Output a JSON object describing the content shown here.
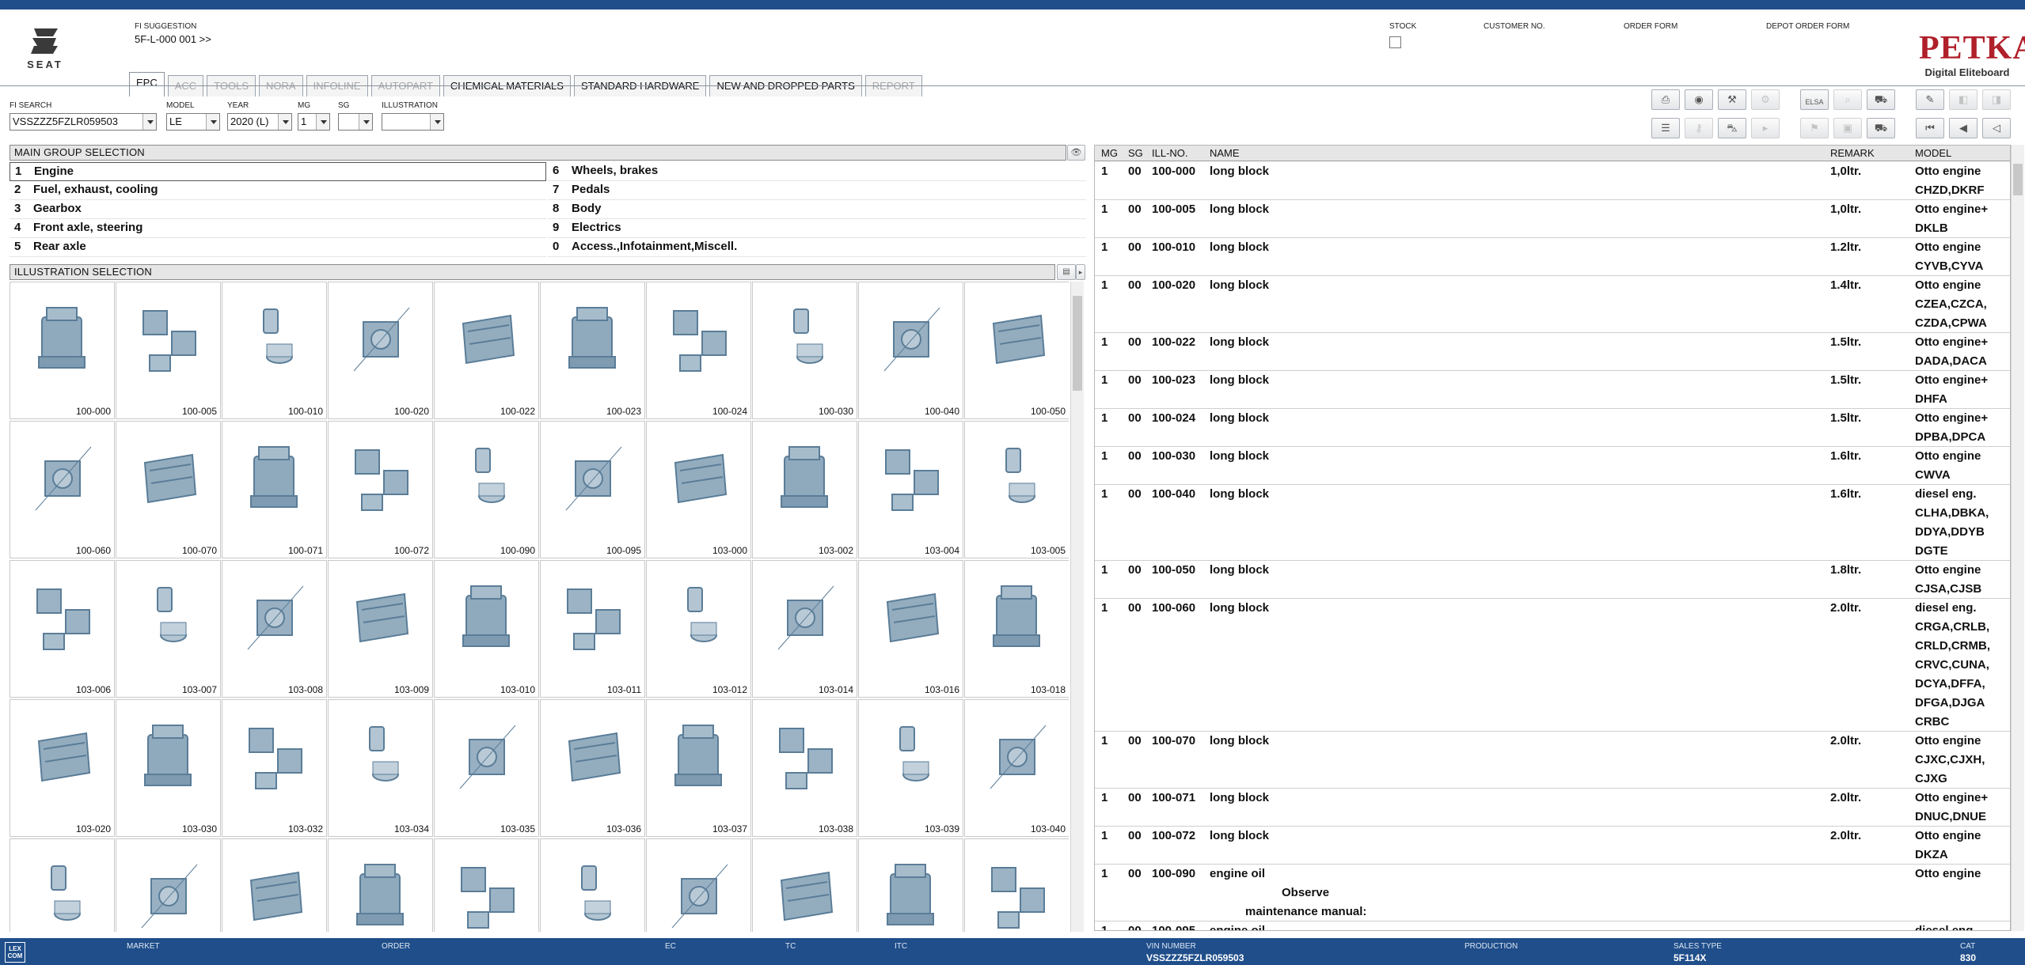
{
  "app": {
    "brand": "SEAT",
    "product_name": "PETKA",
    "product_sub": "Digital Eliteboard"
  },
  "header": {
    "fi_suggestion_label": "FI SUGGESTION",
    "fi_suggestion_value": "5F-L-000 001 >>",
    "stock_label": "STOCK",
    "customer_no_label": "CUSTOMER NO.",
    "order_form_label": "ORDER FORM",
    "depot_order_form_label": "DEPOT ORDER FORM"
  },
  "tabs": [
    {
      "label": "EPC",
      "state": "active"
    },
    {
      "label": "ACC",
      "state": "disabled"
    },
    {
      "label": "TOOLS",
      "state": "disabled"
    },
    {
      "label": "NORA",
      "state": "disabled"
    },
    {
      "label": "INFOLINE",
      "state": "disabled"
    },
    {
      "label": "AUTOPART",
      "state": "disabled"
    },
    {
      "label": "CHEMICAL MATERIALS",
      "state": "enabled"
    },
    {
      "label": "STANDARD HARDWARE",
      "state": "enabled"
    },
    {
      "label": "NEW AND DROPPED PARTS",
      "state": "enabled"
    },
    {
      "label": "REPORT",
      "state": "disabled"
    }
  ],
  "filters": {
    "fi_search": {
      "label": "FI SEARCH",
      "value": "VSSZZZ5FZLR059503"
    },
    "model": {
      "label": "MODEL",
      "value": "LE"
    },
    "year": {
      "label": "YEAR",
      "value": "2020 (L)"
    },
    "mg": {
      "label": "MG",
      "value": "1"
    },
    "sg": {
      "label": "SG",
      "value": ""
    },
    "illustration": {
      "label": "ILLUSTRATION",
      "value": ""
    }
  },
  "toolbar": {
    "row1": [
      "print-icon",
      "catalog-icon",
      "wrench-icon",
      "tools-disabled-icon",
      "elsa-icon",
      "search-disabled-icon",
      "cart-add-icon",
      "pin-icon",
      "back-disabled-icon",
      "forward-disabled-icon"
    ],
    "row2": [
      "list-icon",
      "key-icon",
      "car-icon",
      "next-disabled-icon",
      "flag-disabled-icon",
      "camera-disabled-icon",
      "cart-icon",
      "first-icon",
      "previous-icon",
      "prev-small-icon"
    ],
    "elsa_label": "ELSA"
  },
  "main_group": {
    "title": "MAIN GROUP SELECTION",
    "left": [
      {
        "num": "1",
        "label": "Engine"
      },
      {
        "num": "2",
        "label": "Fuel, exhaust, cooling"
      },
      {
        "num": "3",
        "label": "Gearbox"
      },
      {
        "num": "4",
        "label": "Front axle, steering"
      },
      {
        "num": "5",
        "label": "Rear axle"
      }
    ],
    "right": [
      {
        "num": "6",
        "label": "Wheels, brakes"
      },
      {
        "num": "7",
        "label": "Pedals"
      },
      {
        "num": "8",
        "label": "Body"
      },
      {
        "num": "9",
        "label": "Electrics"
      },
      {
        "num": "0",
        "label": "Access.,Infotainment,Miscell."
      }
    ]
  },
  "illustration_selection": {
    "title": "ILLUSTRATION SELECTION",
    "items": [
      "100-000",
      "100-005",
      "100-010",
      "100-020",
      "100-022",
      "100-023",
      "100-024",
      "100-030",
      "100-040",
      "100-050",
      "100-060",
      "100-070",
      "100-071",
      "100-072",
      "100-090",
      "100-095",
      "103-000",
      "103-002",
      "103-004",
      "103-005",
      "103-006",
      "103-007",
      "103-008",
      "103-009",
      "103-010",
      "103-011",
      "103-012",
      "103-014",
      "103-016",
      "103-018",
      "103-020",
      "103-030",
      "103-032",
      "103-034",
      "103-035",
      "103-036",
      "103-037",
      "103-038",
      "103-039",
      "103-040",
      "",
      "",
      "",
      "",
      "",
      "",
      "",
      "",
      "",
      ""
    ]
  },
  "parts_table": {
    "columns": {
      "mg": "MG",
      "sg": "SG",
      "ill": "ILL-NO.",
      "name": "NAME",
      "remark": "REMARK",
      "model": "MODEL"
    },
    "rows": [
      {
        "mg": "1",
        "sg": "00",
        "ill": "100-000",
        "name": "long block",
        "remark": "1,0ltr.",
        "model": [
          "Otto engine",
          "CHZD,DKRF"
        ]
      },
      {
        "mg": "1",
        "sg": "00",
        "ill": "100-005",
        "name": "long block",
        "remark": "1,0ltr.",
        "model": [
          "Otto engine+",
          "DKLB"
        ]
      },
      {
        "mg": "1",
        "sg": "00",
        "ill": "100-010",
        "name": "long block",
        "remark": "1.2ltr.",
        "model": [
          "Otto engine",
          "CYVB,CYVA"
        ]
      },
      {
        "mg": "1",
        "sg": "00",
        "ill": "100-020",
        "name": "long block",
        "remark": "1.4ltr.",
        "model": [
          "Otto engine",
          "CZEA,CZCA,",
          "CZDA,CPWA"
        ]
      },
      {
        "mg": "1",
        "sg": "00",
        "ill": "100-022",
        "name": "long block",
        "remark": "1.5ltr.",
        "model": [
          "Otto engine+",
          "DADA,DACA"
        ]
      },
      {
        "mg": "1",
        "sg": "00",
        "ill": "100-023",
        "name": "long block",
        "remark": "1.5ltr.",
        "model": [
          "Otto engine+",
          "DHFA"
        ]
      },
      {
        "mg": "1",
        "sg": "00",
        "ill": "100-024",
        "name": "long block",
        "remark": "1.5ltr.",
        "model": [
          "Otto engine+",
          "DPBA,DPCA"
        ]
      },
      {
        "mg": "1",
        "sg": "00",
        "ill": "100-030",
        "name": "long block",
        "remark": "1.6ltr.",
        "model": [
          "Otto engine",
          "CWVA"
        ]
      },
      {
        "mg": "1",
        "sg": "00",
        "ill": "100-040",
        "name": "long block",
        "remark": "1.6ltr.",
        "model": [
          "diesel eng.",
          "CLHA,DBKA,",
          "DDYA,DDYB",
          "DGTE"
        ]
      },
      {
        "mg": "1",
        "sg": "00",
        "ill": "100-050",
        "name": "long block",
        "remark": "1.8ltr.",
        "model": [
          "Otto engine",
          "CJSA,CJSB"
        ]
      },
      {
        "mg": "1",
        "sg": "00",
        "ill": "100-060",
        "name": "long block",
        "remark": "2.0ltr.",
        "model": [
          "diesel eng.",
          "CRGA,CRLB,",
          "CRLD,CRMB,",
          "CRVC,CUNA,",
          "DCYA,DFFA,",
          "DFGA,DJGA",
          "CRBC"
        ]
      },
      {
        "mg": "1",
        "sg": "00",
        "ill": "100-070",
        "name": "long block",
        "remark": "2.0ltr.",
        "model": [
          "Otto engine",
          "CJXC,CJXH,",
          "CJXG"
        ]
      },
      {
        "mg": "1",
        "sg": "00",
        "ill": "100-071",
        "name": "long block",
        "remark": "2.0ltr.",
        "model": [
          "Otto engine+",
          "DNUC,DNUE"
        ]
      },
      {
        "mg": "1",
        "sg": "00",
        "ill": "100-072",
        "name": "long block",
        "remark": "2.0ltr.",
        "model": [
          "Otto engine",
          "DKZA"
        ]
      },
      {
        "mg": "1",
        "sg": "00",
        "ill": "100-090",
        "name": "engine oil",
        "remark": "",
        "model": [
          "Otto engine"
        ],
        "notes": [
          "Observe",
          "maintenance manual:"
        ]
      },
      {
        "mg": "1",
        "sg": "00",
        "ill": "100-095",
        "name": "engine oil",
        "remark": "",
        "model": [
          "diesel eng."
        ]
      }
    ]
  },
  "statusbar": {
    "logo": "LEX COM",
    "market_label": "MARKET",
    "market_value": "",
    "order_label": "ORDER",
    "order_value": "",
    "ec_label": "EC",
    "ec_value": "",
    "tc_label": "TC",
    "tc_value": "",
    "itc_label": "ITC",
    "itc_value": "",
    "vin_label": "VIN NUMBER",
    "vin_value": "VSSZZZ5FZLR059503",
    "production_label": "PRODUCTION",
    "production_value": "",
    "sales_type_label": "SALES TYPE",
    "sales_type_value": "5F114X",
    "cat_label": "CAT",
    "cat_value": "830"
  },
  "colors": {
    "brand_bar": "#1f4e8a",
    "petka_red": "#b0202a",
    "drawing_blue": "#5b7d98"
  }
}
